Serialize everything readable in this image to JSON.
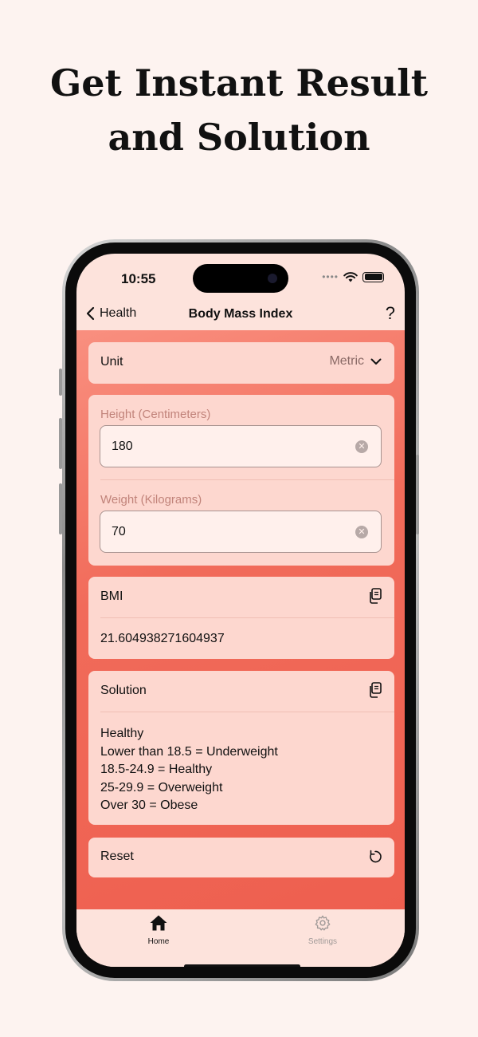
{
  "headline": [
    "Get Instant Result",
    "and Solution"
  ],
  "status_bar": {
    "time": "10:55"
  },
  "nav": {
    "back_label": "Health",
    "title": "Body Mass Index",
    "help_label": "?"
  },
  "unit": {
    "label": "Unit",
    "value": "Metric"
  },
  "height": {
    "label": "Height (Centimeters)",
    "value": "180"
  },
  "weight": {
    "label": "Weight (Kilograms)",
    "value": "70"
  },
  "bmi": {
    "label": "BMI",
    "value": "21.604938271604937"
  },
  "solution": {
    "label": "Solution",
    "lines": [
      "Healthy",
      "Lower than 18.5 = Underweight",
      "18.5-24.9 = Healthy",
      "25-29.9 = Overweight",
      "Over 30 = Obese"
    ]
  },
  "reset": {
    "label": "Reset"
  },
  "tabs": [
    {
      "label": "Home",
      "icon": "home-icon",
      "active": true
    },
    {
      "label": "Settings",
      "icon": "gear-icon",
      "active": false
    }
  ],
  "colors": {
    "page_bg": "#fdf3f0",
    "accent": "#f16b5a",
    "card": "#fdd7cf",
    "label_muted": "#c1837a"
  }
}
